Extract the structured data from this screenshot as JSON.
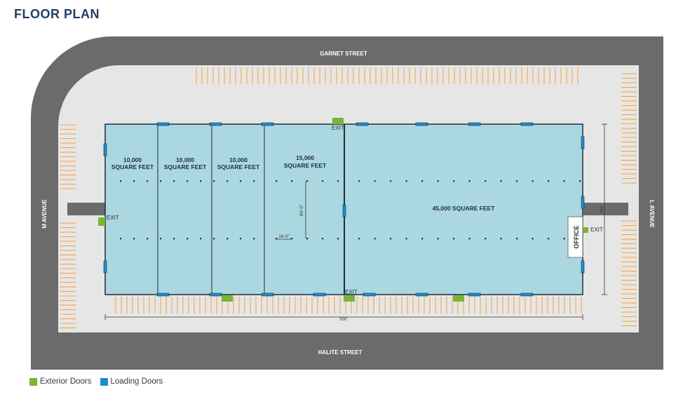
{
  "title": "FLOOR PLAN",
  "streets": {
    "north": "GARNET STREET",
    "south": "HALITE STREET",
    "west": "M AVENUE",
    "east": "L AVENUE"
  },
  "units": [
    {
      "area": "10,000",
      "unit": "SQUARE FEET"
    },
    {
      "area": "10,000",
      "unit": "SQUARE FEET"
    },
    {
      "area": "10,000",
      "unit": "SQUARE FEET"
    },
    {
      "area": "15,000",
      "unit": "SQUARE FEET"
    },
    {
      "area": "45,000 SQUARE FEET",
      "unit": ""
    }
  ],
  "office_label": "OFFICE",
  "exit_label": "EXIT",
  "dimensions": {
    "column_height": "60'-0\"",
    "column_width": "14'-0\"",
    "building_depth": "160'",
    "building_length": "500'"
  },
  "legend": [
    {
      "label": "Exterior Doors",
      "color": "#7ab536"
    },
    {
      "label": "Loading Doors",
      "color": "#1a8fd0"
    }
  ],
  "colors": {
    "road": "#6b6b6b",
    "lot": "#e6e6e6",
    "building": "#abd7e1",
    "parking": "#f5a23a",
    "title": "#1f3f66"
  }
}
